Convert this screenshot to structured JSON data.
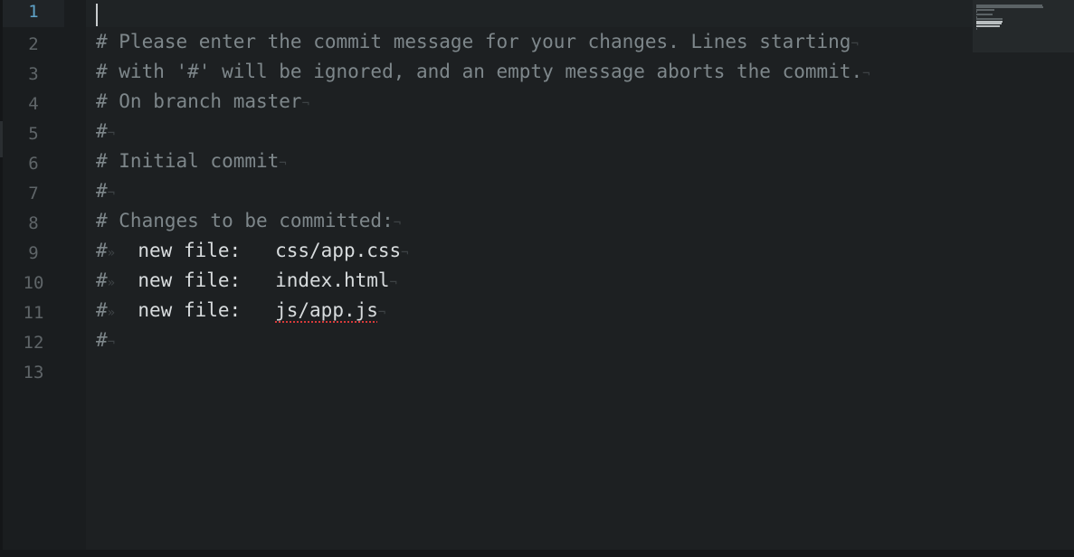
{
  "editor": {
    "active_line": 1,
    "line_numbers": [
      "1",
      "2",
      "3",
      "4",
      "5",
      "6",
      "7",
      "8",
      "9",
      "10",
      "11",
      "12",
      "13"
    ],
    "lines": [
      [],
      [
        {
          "t": "# Please enter the commit message for your changes. Lines starting",
          "s": "comment"
        },
        {
          "t": "¬",
          "s": "invis"
        }
      ],
      [
        {
          "t": "# with '#' will be ignored, and an empty message aborts the commit.",
          "s": "comment"
        },
        {
          "t": "¬",
          "s": "invis"
        }
      ],
      [
        {
          "t": "# On branch master",
          "s": "comment"
        },
        {
          "t": "¬",
          "s": "invis"
        }
      ],
      [
        {
          "t": "#",
          "s": "comment"
        },
        {
          "t": "¬",
          "s": "invis"
        }
      ],
      [
        {
          "t": "# Initial commit",
          "s": "comment"
        },
        {
          "t": "¬",
          "s": "invis"
        }
      ],
      [
        {
          "t": "#",
          "s": "comment"
        },
        {
          "t": "¬",
          "s": "invis"
        }
      ],
      [
        {
          "t": "# Changes to be committed:",
          "s": "comment"
        },
        {
          "t": "¬",
          "s": "invis"
        }
      ],
      [
        {
          "t": "#",
          "s": "comment"
        },
        {
          "t": "»",
          "s": "invis"
        },
        {
          "t": "  new file:   css/app.css",
          "s": "plain"
        },
        {
          "t": "¬",
          "s": "invis"
        }
      ],
      [
        {
          "t": "#",
          "s": "comment"
        },
        {
          "t": "»",
          "s": "invis"
        },
        {
          "t": "  new file:   index.html",
          "s": "plain"
        },
        {
          "t": "¬",
          "s": "invis"
        }
      ],
      [
        {
          "t": "#",
          "s": "comment"
        },
        {
          "t": "»",
          "s": "invis"
        },
        {
          "t": "  new file:   ",
          "s": "plain"
        },
        {
          "t": "js/app.js",
          "s": "spell"
        },
        {
          "t": "¬",
          "s": "invis"
        }
      ],
      [
        {
          "t": "#",
          "s": "comment"
        },
        {
          "t": "¬",
          "s": "invis"
        }
      ],
      []
    ]
  },
  "colors": {
    "background": "#1d2022",
    "gutter": "#1a1d1f",
    "comment": "#7e878b",
    "plain": "#d8dcde",
    "active_line_number": "#5fa3c9",
    "spellcheck_underline": "#d63a3a"
  },
  "icons": {
    "newline_marker": "pilcrow-not-sign",
    "tab_marker": "double-chevron-right"
  }
}
